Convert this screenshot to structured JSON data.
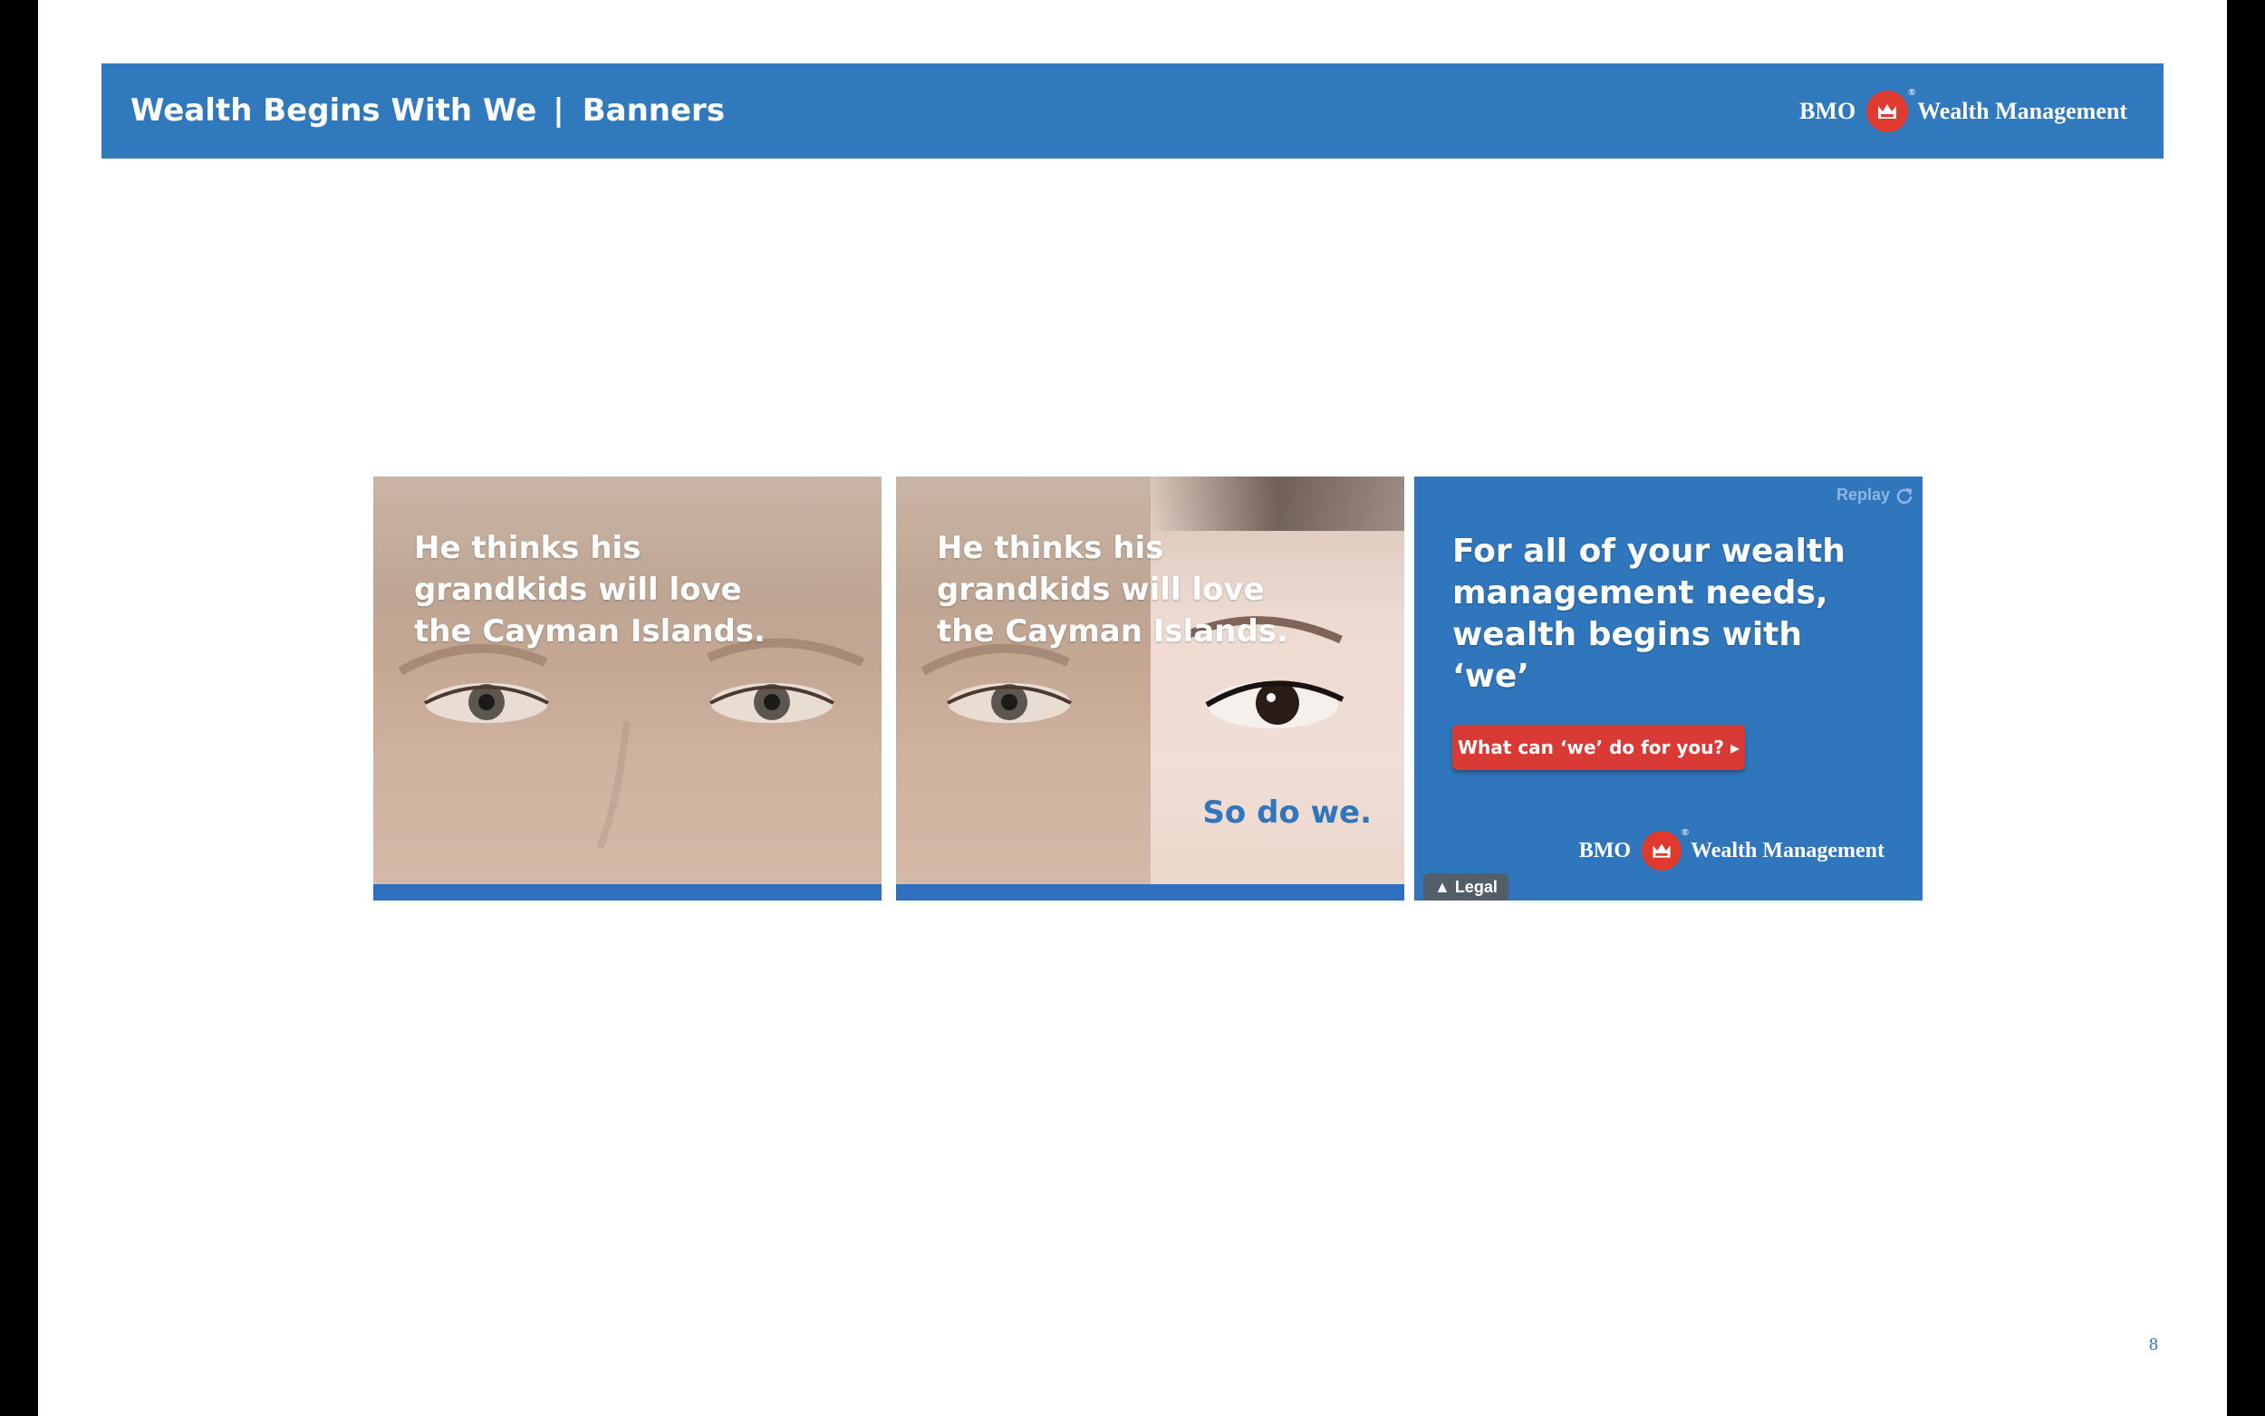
{
  "header": {
    "title": "Wealth Begins With We",
    "separator": "|",
    "section": "Banners",
    "logo_left": "BMO",
    "logo_right": "Wealth Management",
    "registered": "®"
  },
  "banners": [
    {
      "headline": "He thinks his grandkids will love the Cayman Islands."
    },
    {
      "headline": "He thinks his grandkids will love the Cayman Islands.",
      "tagline": "So do we."
    },
    {
      "headline": "For all of your wealth management needs, wealth begins with ‘we’",
      "replay": "Replay",
      "cta": "What can ‘we’ do for you? ▸",
      "logo_left": "BMO",
      "logo_right": "Wealth Management",
      "legal": "▲ Legal"
    }
  ],
  "page_number": "8",
  "colors": {
    "brand_blue": "#3079bd",
    "brand_red": "#e03a2f",
    "cta_red": "#d93a36"
  }
}
